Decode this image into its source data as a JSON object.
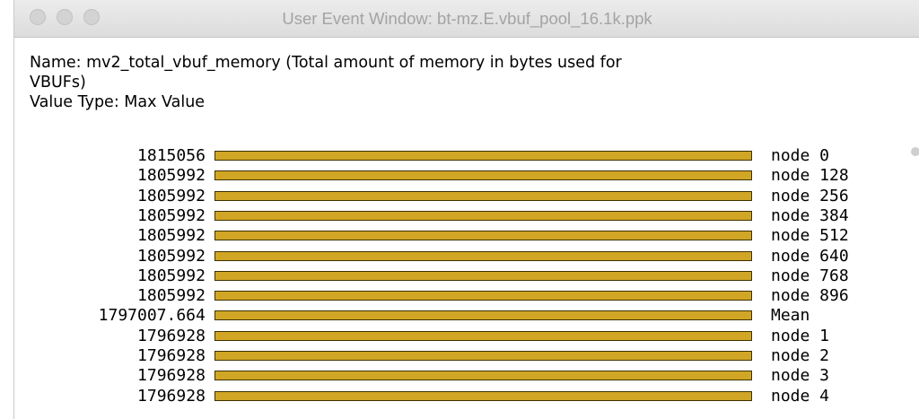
{
  "window": {
    "title": "User Event Window: bt-mz.E.vbuf_pool_16.1k.ppk"
  },
  "info": {
    "name_line1": "Name: mv2_total_vbuf_memory (Total amount of memory in bytes used for",
    "name_line2": "VBUFs)",
    "value_type": "Value Type: Max Value"
  },
  "chart_data": {
    "type": "bar",
    "orientation": "horizontal",
    "categories": [
      "node 0",
      "node 128",
      "node 256",
      "node 384",
      "node 512",
      "node 640",
      "node 768",
      "node 896",
      "Mean",
      "node 1",
      "node 2",
      "node 3",
      "node 4"
    ],
    "value_labels": [
      "1815056",
      "1805992",
      "1805992",
      "1805992",
      "1805992",
      "1805992",
      "1805992",
      "1805992",
      "1797007.664",
      "1796928",
      "1796928",
      "1796928",
      "1796928"
    ],
    "values": [
      1815056,
      1805992,
      1805992,
      1805992,
      1805992,
      1805992,
      1805992,
      1805992,
      1797007.664,
      1796928,
      1796928,
      1796928,
      1796928
    ],
    "bar_color": "#d1a625",
    "bar_border_color": "#3d3100"
  }
}
